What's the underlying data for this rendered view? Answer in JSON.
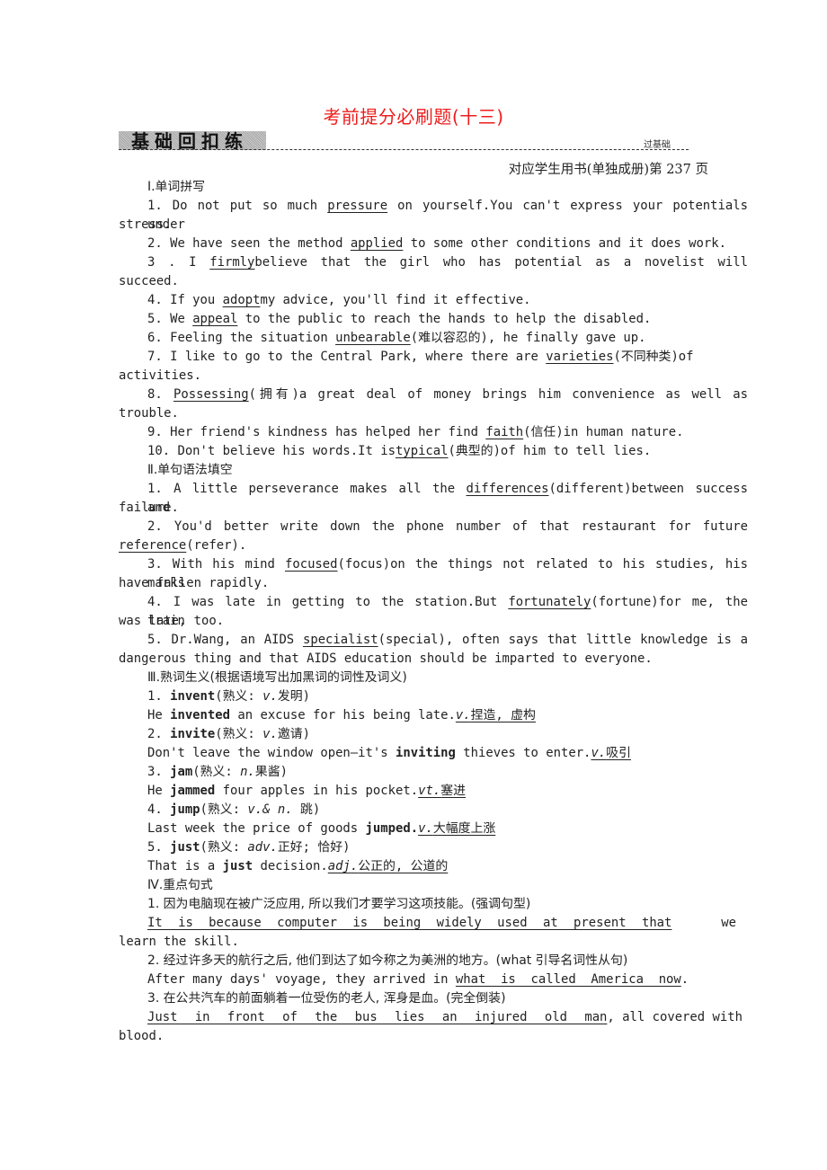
{
  "header": {
    "title": "考前提分必刷题(十三)",
    "section_band": "基础回扣练",
    "section_tag": "过基础",
    "page_ref": "对应学生用书(单独成册)第 237 页"
  },
  "sections": {
    "s1": {
      "heading": "Ⅰ.单词拼写",
      "q1": {
        "pre": "1. Do not put so much ",
        "ans": "pressure",
        "post": " on yourself.You can't express your potentials under",
        "cont": "stress."
      },
      "q2": {
        "pre": "2. We have seen the method ",
        "ans": "applied",
        "post": " to some other conditions and it does work."
      },
      "q3": {
        "pre": "3 . I ",
        "ans": "firmly",
        "post": "believe that the girl who has potential as a novelist will",
        "cont": "succeed."
      },
      "q4": {
        "pre": "4. If you ",
        "ans": "adopt",
        "post": "my advice, you'll find it effective."
      },
      "q5": {
        "pre": "5. We ",
        "ans": "appeal",
        "post": " to the public to reach the hands to help the disabled."
      },
      "q6": {
        "pre": "6. Feeling the situation ",
        "ans": "unbearable",
        "post": "(难以容忍的), he finally gave up."
      },
      "q7": {
        "pre": "7. I like to go to the Central Park, where there are ",
        "ans": "varieties",
        "post": "(不同种类)of",
        "cont": "activities."
      },
      "q8": {
        "pre": "8. ",
        "ans": "Possessing",
        "post": "(拥有)a great deal of money brings him convenience as well as",
        "cont": "trouble."
      },
      "q9": {
        "pre": "9. Her friend's kindness has helped her find ",
        "ans": "faith",
        "post": "(信任)in human nature."
      },
      "q10": {
        "pre": "10. Don't believe his words.It is",
        "ans": "typical",
        "post": "(典型的)of him to tell lies."
      }
    },
    "s2": {
      "heading": "Ⅱ.单句语法填空",
      "q1": {
        "pre": "1. A little perseverance makes all the ",
        "ans": "differences",
        "post": "(different)between success and",
        "cont": "failure."
      },
      "q2": {
        "pre": "2. You'd better write down the phone number of that restaurant for future",
        "ans": "reference",
        "post": "(refer)."
      },
      "q3": {
        "pre": "3. With his mind ",
        "ans": "focused",
        "post": "(focus)on the things not related to his studies, his marks",
        "cont": "have fallen rapidly."
      },
      "q4": {
        "pre": "4. I was late in getting to the station.But ",
        "ans": "fortunately",
        "post": "(fortune)for me, the train",
        "cont": "was late, too."
      },
      "q5": {
        "pre": "5. Dr.Wang, an AIDS ",
        "ans": "specialist",
        "post": "(special), often says that little knowledge is a",
        "cont": "dangerous thing and that AIDS education should be imparted to everyone."
      }
    },
    "s3": {
      "heading": "Ⅲ.熟词生义(根据语境写出加黑词的词性及词义)",
      "items": [
        {
          "num": "1. ",
          "word": "invent",
          "meaning_pre": "(熟义: ",
          "pos": "v.",
          "meaning": "发明)",
          "ex_pre": "He ",
          "ex_bold": "invented",
          "ex_post": " an excuse for his being late.",
          "ans_pos": "v.",
          "ans": "捏造, 虚构"
        },
        {
          "num": "2. ",
          "word": "invite",
          "meaning_pre": "(熟义: ",
          "pos": "v.",
          "meaning": "邀请)",
          "ex_pre": "Don't leave the window open—it's ",
          "ex_bold": "inviting",
          "ex_post": " thieves to enter.",
          "ans_pos": "v.",
          "ans": "吸引"
        },
        {
          "num": "3. ",
          "word": "jam",
          "meaning_pre": "(熟义: ",
          "pos": "n.",
          "meaning": "果酱)",
          "ex_pre": "He ",
          "ex_bold": "jammed",
          "ex_post": " four apples in his pocket.",
          "ans_pos": "vt.",
          "ans": "塞进"
        },
        {
          "num": "4. ",
          "word": "jump",
          "meaning_pre": "(熟义: ",
          "pos": "v.& n.",
          "meaning": " 跳)",
          "ex_pre": "Last week the price of goods ",
          "ex_bold": "jumped.",
          "ex_post": "",
          "ans_pos": "v.",
          "ans": "大幅度上涨"
        },
        {
          "num": "5. ",
          "word": "just",
          "meaning_pre": "(熟义: ",
          "pos": "adv.",
          "meaning": "正好; 恰好)",
          "ex_pre": "That is a ",
          "ex_bold": "just",
          "ex_post": " decision.",
          "ans_pos": "adj.",
          "ans": "公正的, 公道的"
        }
      ]
    },
    "s4": {
      "heading": "Ⅳ.重点句式",
      "q1": {
        "prompt": "1. 因为电脑现在被广泛应用, 所以我们才要学习这项技能。(强调句型)",
        "ans": "It is because computer is being widely used at present that",
        "post": "we",
        "cont": "learn the skill."
      },
      "q2": {
        "prompt": "2. 经过许多天的航行之后, 他们到达了如今称之为美洲的地方。(what 引导名词性从句)",
        "pre": "After many days' voyage, they arrived in ",
        "ans": "what  is  called  America  now",
        "post": "."
      },
      "q3": {
        "prompt": "3. 在公共汽车的前面躺着一位受伤的老人, 浑身是血。(完全倒装)",
        "ans": "Just in front of the bus lies an injured old man",
        "post": ", all covered with",
        "cont": "blood."
      }
    }
  }
}
